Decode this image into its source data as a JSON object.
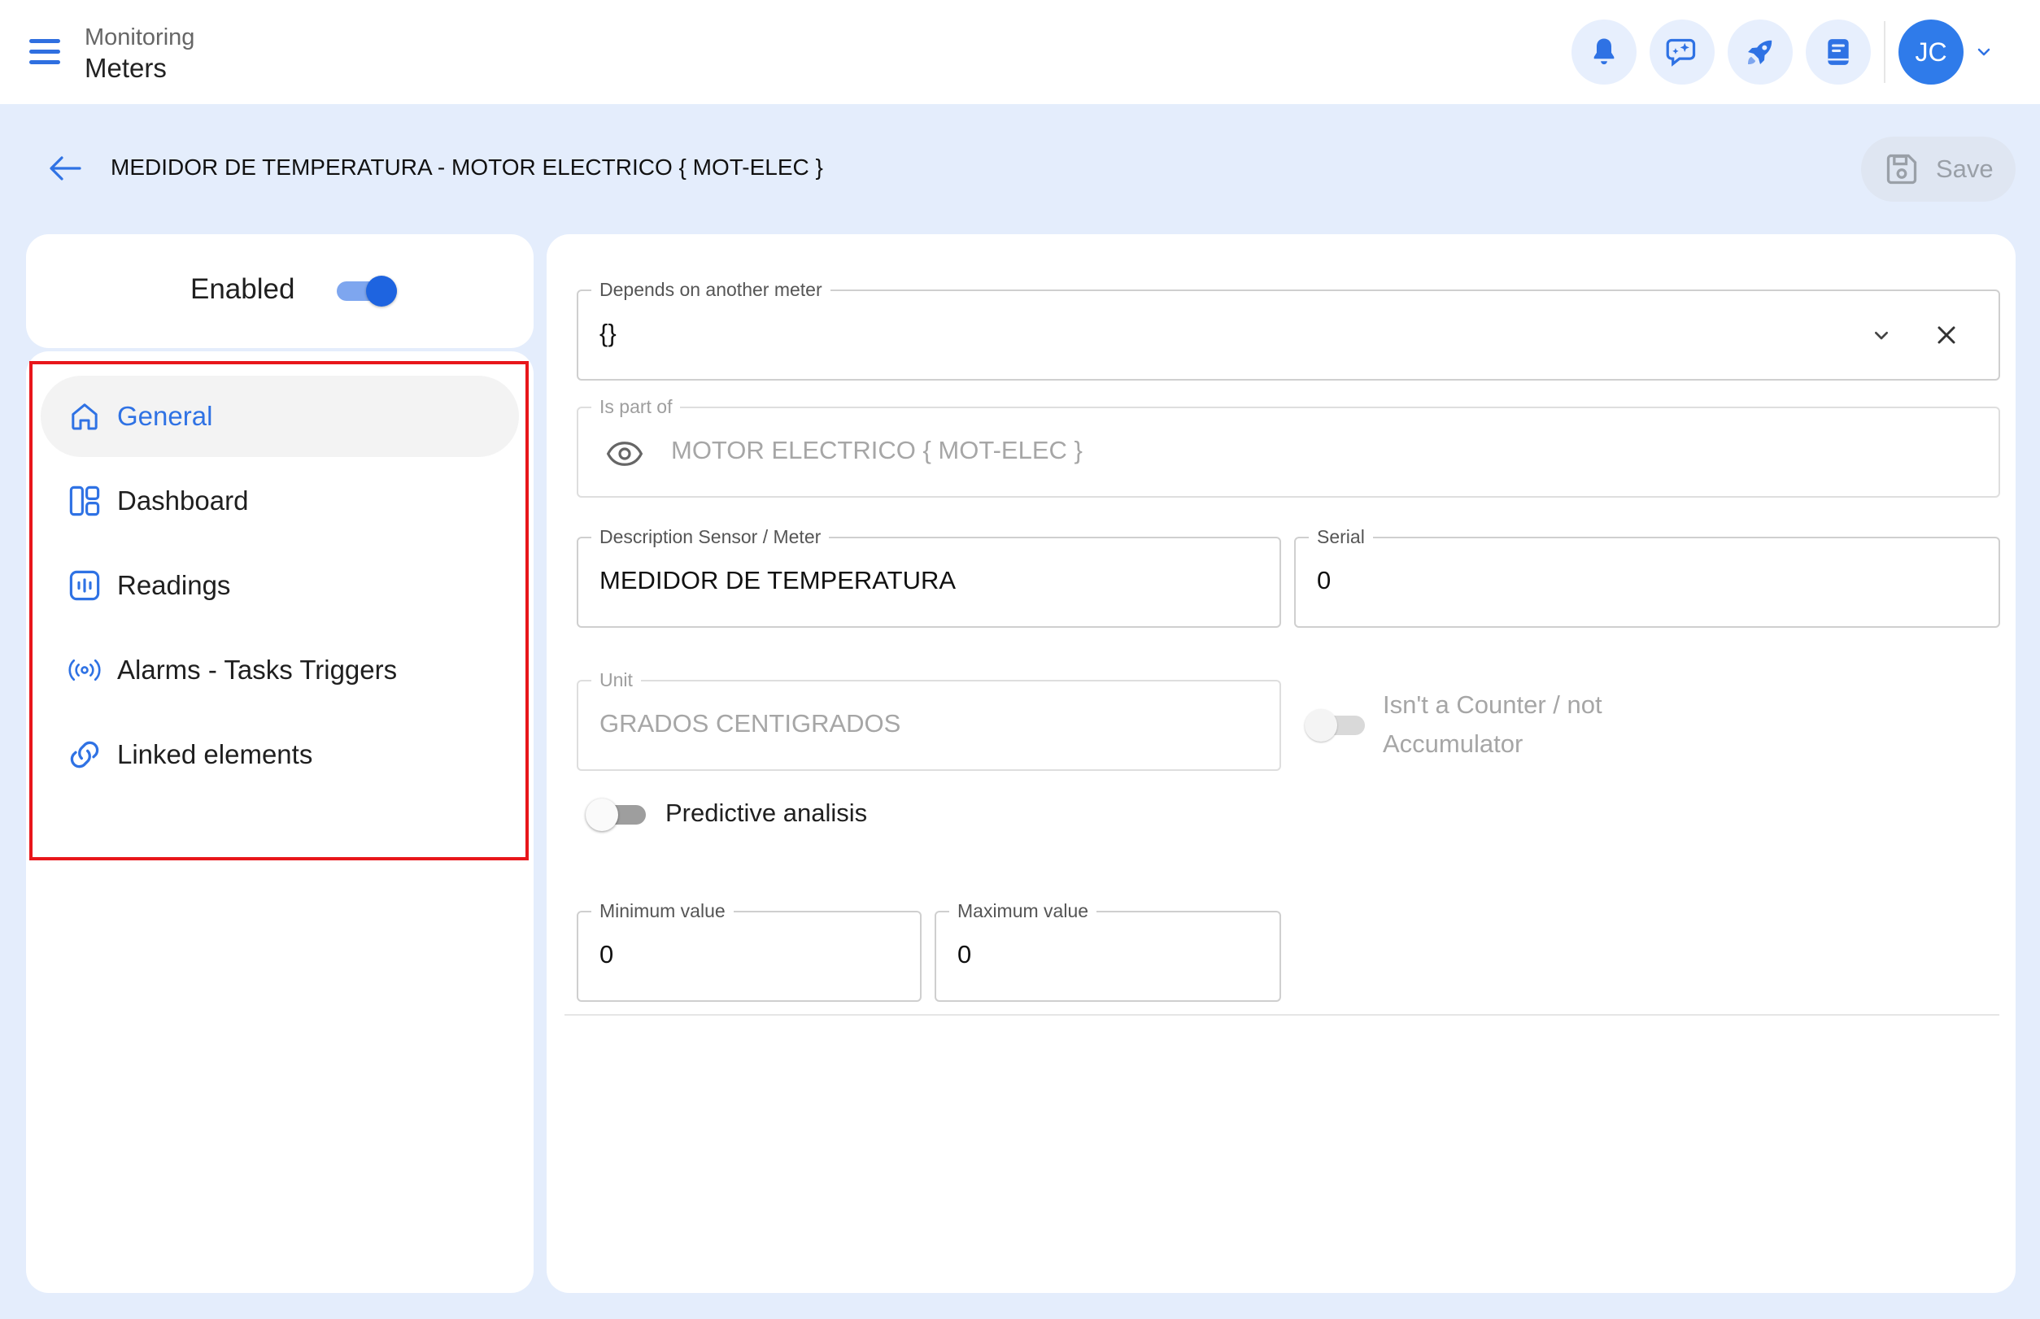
{
  "topbar": {
    "breadcrumb_parent": "Monitoring",
    "breadcrumb_current": "Meters",
    "actions": [
      "bell-icon",
      "chat-sparkle-icon",
      "rocket-icon",
      "book-icon"
    ],
    "user_initials": "JC"
  },
  "header": {
    "title": "MEDIDOR DE TEMPERATURA - MOTOR ELECTRICO { MOT-ELEC }",
    "save_label": "Save"
  },
  "status": {
    "enabled_label": "Enabled",
    "enabled": true
  },
  "nav": {
    "items": [
      {
        "label": "General",
        "icon": "home-icon",
        "active": true
      },
      {
        "label": "Dashboard",
        "icon": "dashboard-icon",
        "active": false
      },
      {
        "label": "Readings",
        "icon": "readings-icon",
        "active": false
      },
      {
        "label": "Alarms - Tasks Triggers",
        "icon": "broadcast-icon",
        "active": false
      },
      {
        "label": "Linked elements",
        "icon": "link-icon",
        "active": false
      }
    ]
  },
  "form": {
    "depends_on": {
      "label": "Depends on another meter",
      "value": "{}"
    },
    "part_of": {
      "label": "Is part of",
      "value": "MOTOR ELECTRICO { MOT-ELEC }"
    },
    "description": {
      "label": "Description Sensor / Meter",
      "value": "MEDIDOR DE TEMPERATURA"
    },
    "serial": {
      "label": "Serial",
      "value": "0"
    },
    "unit": {
      "label": "Unit",
      "value": "GRADOS CENTIGRADOS"
    },
    "not_counter": {
      "label_line1": "Isn't a Counter / not",
      "label_line2": "Accumulator",
      "enabled": false
    },
    "predictive": {
      "label": "Predictive analisis",
      "enabled": false
    },
    "min_value": {
      "label": "Minimum value",
      "value": "0"
    },
    "max_value": {
      "label": "Maximum value",
      "value": "0"
    }
  },
  "colors": {
    "accent": "#2f72e4",
    "background": "#e4edfc",
    "highlight_border": "#e8161b"
  }
}
